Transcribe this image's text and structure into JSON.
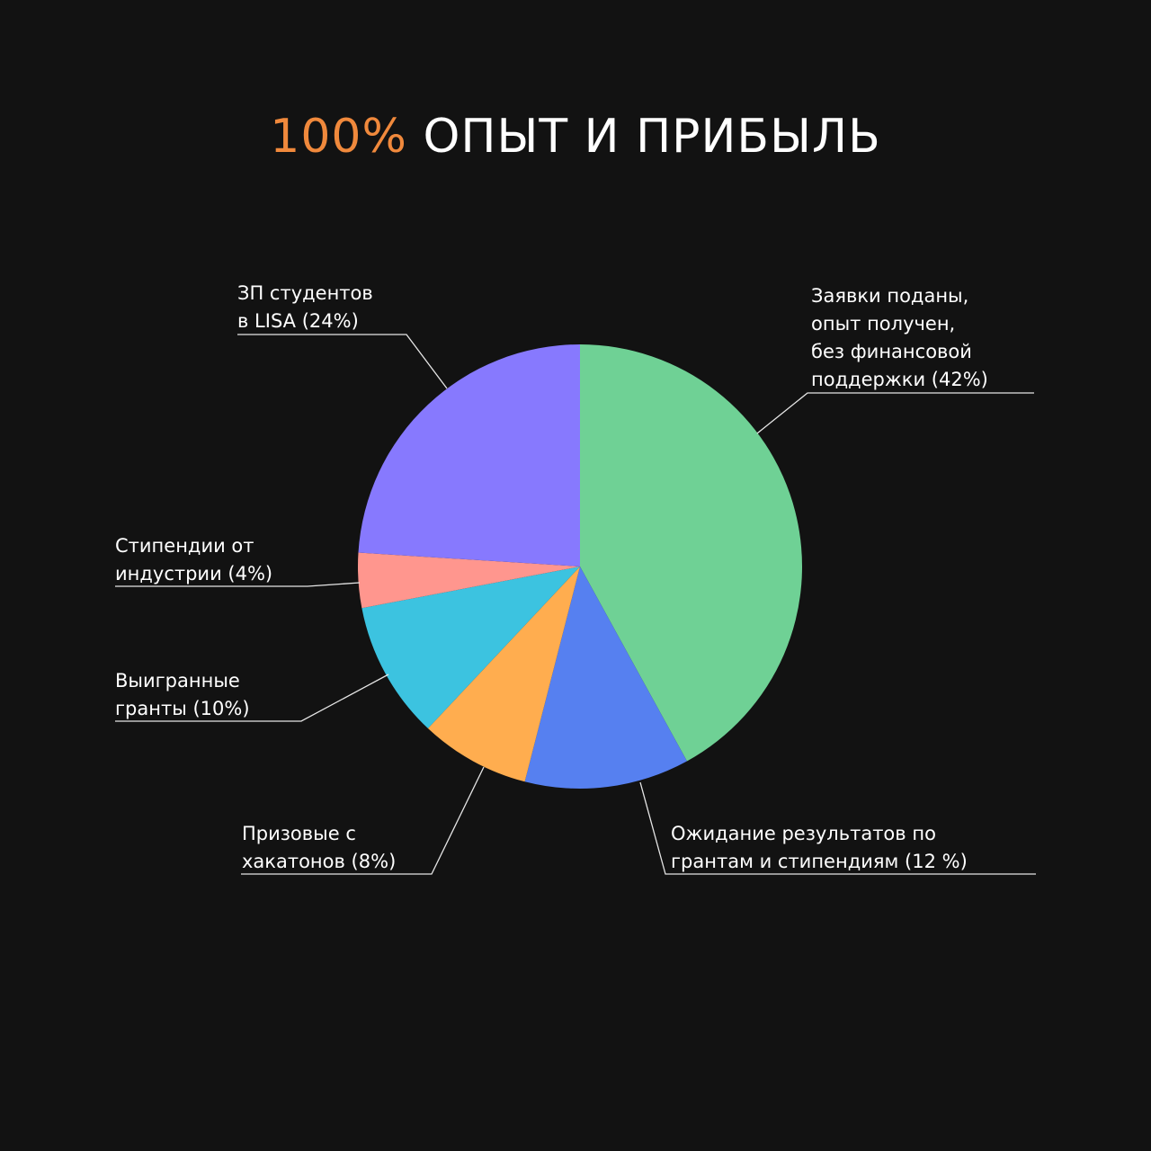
{
  "title": {
    "accent": "100%",
    "rest": "ОПЫТ И ПРИБЫЛЬ"
  },
  "colors": {
    "background": "#121212",
    "accent": "#f0893c",
    "text": "#ffffff"
  },
  "chart_data": {
    "type": "pie",
    "title": "100% ОПЫТ И ПРИБЫЛЬ",
    "start_angle_deg": 0,
    "direction": "clockwise",
    "legend": "none",
    "slices": [
      {
        "key": "applications",
        "value": 42,
        "color": "#6fd195",
        "label": [
          "Заявки поданы,",
          "опыт получен,",
          "без финансовой",
          "поддержки (42%)"
        ]
      },
      {
        "key": "waiting",
        "value": 12,
        "color": "#5680f0",
        "label": [
          "Ожидание результатов по",
          "грантам и стипендиям (12 %)"
        ]
      },
      {
        "key": "hackathons",
        "value": 8,
        "color": "#ffad4f",
        "label": [
          "Призовые с",
          "хакатонов (8%)"
        ]
      },
      {
        "key": "grants",
        "value": 10,
        "color": "#3cc3e0",
        "label": [
          "Выигранные",
          "гранты (10%)"
        ]
      },
      {
        "key": "stipends",
        "value": 4,
        "color": "#ff968e",
        "label": [
          "Стипендии от",
          "индустрии (4%)"
        ]
      },
      {
        "key": "salary",
        "value": 24,
        "color": "#8779fe",
        "label": [
          "ЗП студентов",
          "в LISA (24%)"
        ]
      }
    ]
  }
}
